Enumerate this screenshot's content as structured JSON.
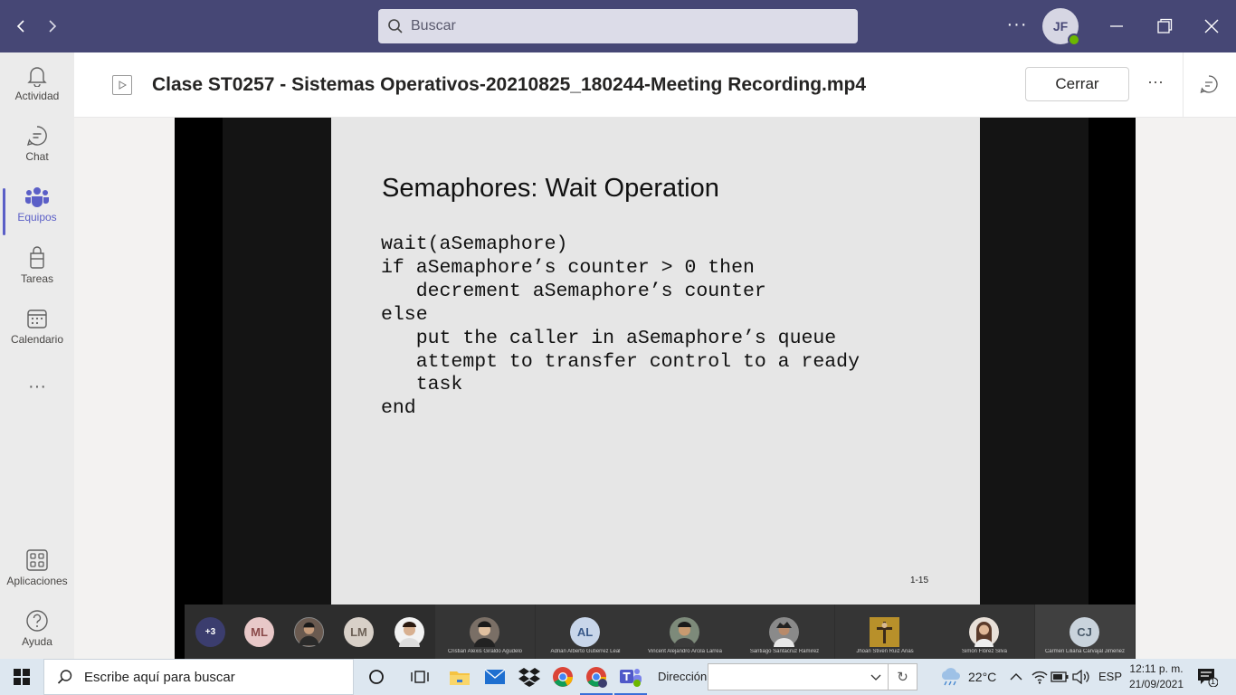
{
  "titlebar": {
    "search_placeholder": "Buscar",
    "avatar_initials": "JF"
  },
  "rail": {
    "items": [
      {
        "label": "Actividad",
        "icon": "bell-icon"
      },
      {
        "label": "Chat",
        "icon": "chat-icon"
      },
      {
        "label": "Equipos",
        "icon": "teams-icon",
        "active": true
      },
      {
        "label": "Tareas",
        "icon": "tasks-icon"
      },
      {
        "label": "Calendario",
        "icon": "calendar-icon"
      }
    ],
    "more": "···",
    "bottom": [
      {
        "label": "Aplicaciones",
        "icon": "apps-icon"
      },
      {
        "label": "Ayuda",
        "icon": "help-icon"
      }
    ]
  },
  "header": {
    "file_title": "Clase ST0257 - Sistemas Operativos-20210825_180244-Meeting Recording.mp4",
    "close_label": "Cerrar",
    "more": "···"
  },
  "slide": {
    "title": "Semaphores: Wait Operation",
    "code_lines": [
      "wait(aSemaphore)",
      "if aSemaphore’s counter > 0 then",
      "   decrement aSemaphore’s counter",
      "else",
      "   put the caller in aSemaphore’s queue",
      "   attempt to transfer control to a ready",
      "   task",
      "end"
    ],
    "page_number": "1-15"
  },
  "participants": {
    "overflow": "+3",
    "small": [
      {
        "initials": "ML",
        "bg": "#e8c8c8",
        "fg": "#8a4a4a"
      },
      {
        "initials": "",
        "photo": true
      },
      {
        "initials": "LM",
        "bg": "#d8d0c8",
        "fg": "#6e6258"
      },
      {
        "initials": "",
        "photo": true
      }
    ],
    "tiles": [
      {
        "name": "Cristian Alexis Giraldo Agudelo",
        "initials": "",
        "photo": true
      },
      {
        "name": "Adrian Alberto Gutierrez Leal",
        "initials": "AL",
        "bg": "#c8d6ea",
        "fg": "#3a5a8a"
      },
      {
        "name": "Vincent Alejandro Arcila Larrea",
        "initials": "",
        "photo": true
      },
      {
        "name": "Santiago Santacruz Ramirez",
        "initials": "",
        "photo": true
      },
      {
        "name": "Jhoan Stiven Ruiz Arias",
        "initials": "",
        "photo": true
      },
      {
        "name": "Simón Flórez Silva",
        "initials": "",
        "photo": true
      },
      {
        "name": "Carmen Liliana Carvajal Jimenez",
        "initials": "CJ",
        "bg": "#c9d3dc",
        "fg": "#4a5a6a"
      }
    ]
  },
  "taskbar": {
    "search_placeholder": "Escribe aquí para buscar",
    "address_label": "Dirección",
    "temperature": "22°C",
    "language": "ESP",
    "time": "12:11 p. m.",
    "date": "21/09/2021",
    "notification_count": "1"
  },
  "colors": {
    "titlebar": "#464775",
    "accent": "#5b5fc7",
    "presence": "#6bb700"
  }
}
